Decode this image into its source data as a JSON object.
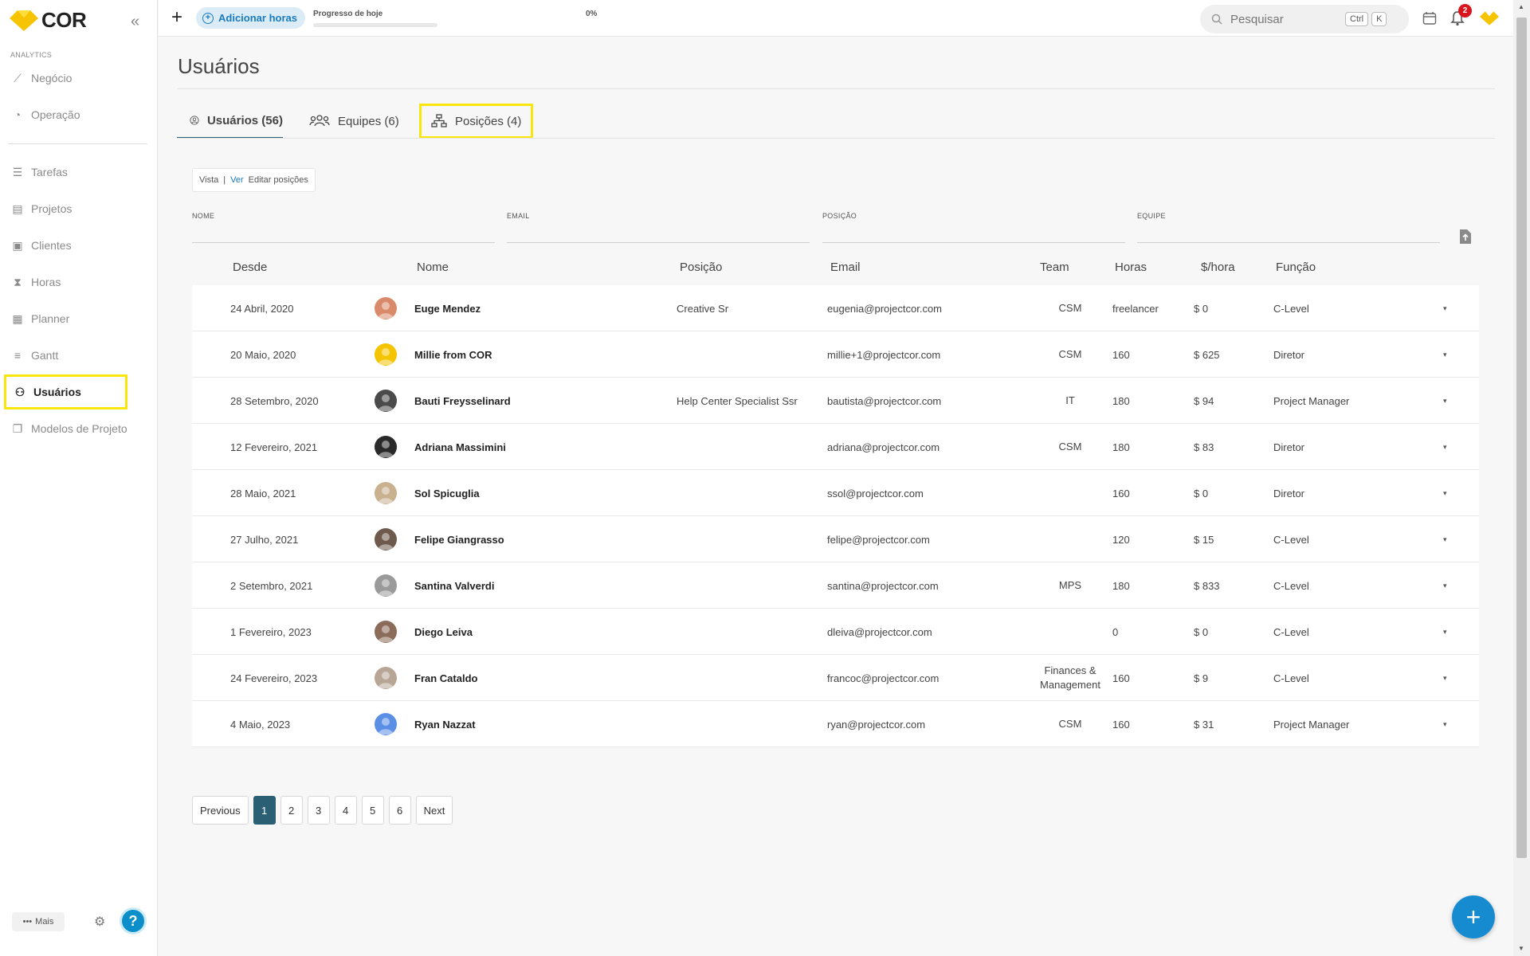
{
  "app": {
    "logo_text": "COR",
    "section_label": "ANALYTICS"
  },
  "sidebar": {
    "analytics": [
      {
        "label": "Negócio",
        "icon": "chart-icon"
      },
      {
        "label": "Operação",
        "icon": "gauge-icon"
      }
    ],
    "items": [
      {
        "label": "Tarefas",
        "icon": "tasks-icon"
      },
      {
        "label": "Projetos",
        "icon": "document-icon"
      },
      {
        "label": "Clientes",
        "icon": "contact-icon"
      },
      {
        "label": "Horas",
        "icon": "hourglass-icon"
      },
      {
        "label": "Planner",
        "icon": "calendar-icon"
      },
      {
        "label": "Gantt",
        "icon": "gantt-icon"
      },
      {
        "label": "Usuários",
        "icon": "users-icon",
        "active": true
      },
      {
        "label": "Modelos de Projeto",
        "icon": "copy-icon"
      }
    ],
    "more_label": "Mais"
  },
  "topbar": {
    "add_hours_label": "Adicionar horas",
    "progress_label": "Progresso de hoje",
    "progress_value": "0%",
    "progress_fraction": 0,
    "search_placeholder": "Pesquisar",
    "kbd_ctrl": "Ctrl",
    "kbd_k": "K",
    "notification_count": "2"
  },
  "page": {
    "title": "Usuários",
    "tabs": [
      {
        "label": "Usuários (56)"
      },
      {
        "label": "Equipes (6)"
      },
      {
        "label": "Posições (4)"
      }
    ],
    "view_toggle": {
      "vista": "Vista",
      "sep": "|",
      "ver": "Ver",
      "edit": "Editar posições"
    },
    "filters": [
      {
        "label": "NOME"
      },
      {
        "label": "EMAIL"
      },
      {
        "label": "POSIÇÃO"
      },
      {
        "label": "EQUIPE"
      }
    ]
  },
  "table": {
    "columns": [
      "Desde",
      "Nome",
      "Posição",
      "Email",
      "Team",
      "Horas",
      "$/hora",
      "Função"
    ],
    "rows": [
      {
        "since": "24 Abril, 2020",
        "name": "Euge Mendez",
        "position": "Creative Sr",
        "email": "eugenia@projectcor.com",
        "team": "CSM",
        "hours": "freelancer",
        "rate": "$ 0",
        "role": "C-Level",
        "avatar_color": "#d98a6a"
      },
      {
        "since": "20 Maio, 2020",
        "name": "Millie from COR",
        "position": "",
        "email": "millie+1@projectcor.com",
        "team": "CSM",
        "hours": "160",
        "rate": "$ 625",
        "role": "Diretor",
        "avatar_color": "#f5c400"
      },
      {
        "since": "28 Setembro, 2020",
        "name": "Bauti Freysselinard",
        "position": "Help Center Specialist Ssr",
        "email": "bautista@projectcor.com",
        "team": "IT",
        "hours": "180",
        "rate": "$ 94",
        "role": "Project Manager",
        "avatar_color": "#4a4a4a"
      },
      {
        "since": "12 Fevereiro, 2021",
        "name": "Adriana Massimini",
        "position": "",
        "email": "adriana@projectcor.com",
        "team": "CSM",
        "hours": "180",
        "rate": "$ 83",
        "role": "Diretor",
        "avatar_color": "#2a2a2a"
      },
      {
        "since": "28 Maio, 2021",
        "name": "Sol Spicuglia",
        "position": "",
        "email": "ssol@projectcor.com",
        "team": "",
        "hours": "160",
        "rate": "$ 0",
        "role": "Diretor",
        "avatar_color": "#c9b08e"
      },
      {
        "since": "27 Julho, 2021",
        "name": "Felipe Giangrasso",
        "position": "",
        "email": "felipe@projectcor.com",
        "team": "",
        "hours": "120",
        "rate": "$ 15",
        "role": "C-Level",
        "avatar_color": "#6d5a4c"
      },
      {
        "since": "2 Setembro, 2021",
        "name": "Santina Valverdi",
        "position": "",
        "email": "santina@projectcor.com",
        "team": "MPS",
        "hours": "180",
        "rate": "$ 833",
        "role": "C-Level",
        "avatar_color": "#9a9a9a"
      },
      {
        "since": "1 Fevereiro, 2023",
        "name": "Diego Leiva",
        "position": "",
        "email": "dleiva@projectcor.com",
        "team": "",
        "hours": "0",
        "rate": "$ 0",
        "role": "C-Level",
        "avatar_color": "#8b6b5a"
      },
      {
        "since": "24 Fevereiro, 2023",
        "name": "Fran Cataldo",
        "position": "",
        "email": "francoc@projectcor.com",
        "team": "Finances & Management",
        "hours": "160",
        "rate": "$ 9",
        "role": "C-Level",
        "avatar_color": "#b7a695"
      },
      {
        "since": "4 Maio, 2023",
        "name": "Ryan Nazzat",
        "position": "",
        "email": "ryan@projectcor.com",
        "team": "CSM",
        "hours": "160",
        "rate": "$ 31",
        "role": "Project Manager",
        "avatar_color": "#5b8fe6"
      }
    ]
  },
  "pagination": {
    "previous": "Previous",
    "pages": [
      "1",
      "2",
      "3",
      "4",
      "5",
      "6"
    ],
    "current": "1",
    "next": "Next"
  },
  "colors": {
    "accent_yellow": "#fae60c",
    "brand_blue": "#178bd0",
    "active_teal": "#2b5f73"
  }
}
